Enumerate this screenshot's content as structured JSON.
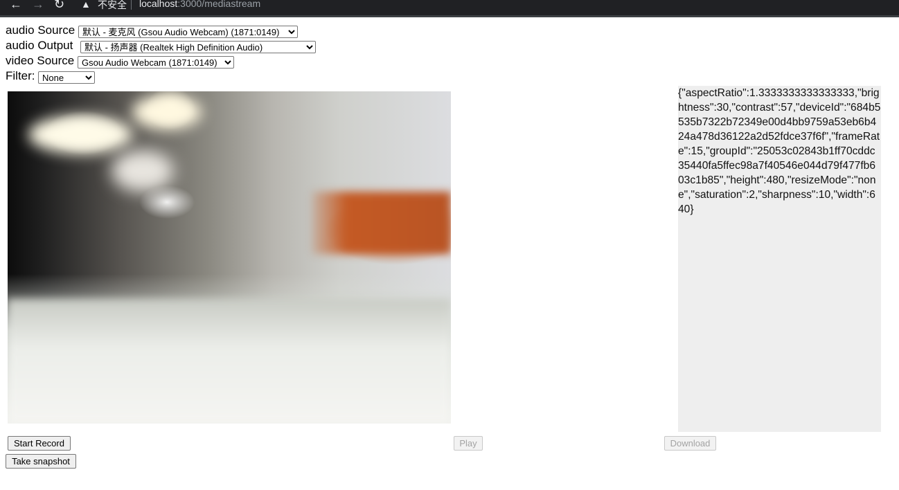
{
  "browser": {
    "insecure_label": "不安全",
    "url_host": "localhost",
    "url_path": ":3000/mediastream"
  },
  "controls": {
    "audio_source": {
      "label": "audio Source",
      "value": "默认 - 麦克风 (Gsou Audio Webcam) (1871:0149)"
    },
    "audio_output": {
      "label": "audio Output",
      "value": "默认 - 扬声器 (Realtek High Definition Audio)"
    },
    "video_source": {
      "label": "video Source",
      "value": "Gsou Audio Webcam (1871:0149)"
    },
    "filter": {
      "label": "Filter:",
      "value": "None"
    }
  },
  "settings_json": "{\"aspectRatio\":1.3333333333333333,\"brightness\":30,\"contrast\":57,\"deviceId\":\"684b5535b7322b72349e00d4bb9759a53eb6b424a478d36122a2d52fdce37f6f\",\"frameRate\":15,\"groupId\":\"25053c02843b1ff70cddc35440fa5ffec98a7f40546e044d79f477fb603c1b85\",\"height\":480,\"resizeMode\":\"none\",\"saturation\":2,\"sharpness\":10,\"width\":640}",
  "buttons": {
    "start_record": "Start Record",
    "play": "Play",
    "download": "Download",
    "take_snapshot": "Take snapshot"
  },
  "icons": {
    "back": "back-arrow-icon",
    "forward": "forward-arrow-icon",
    "reload": "reload-icon",
    "warning": "warning-icon"
  }
}
